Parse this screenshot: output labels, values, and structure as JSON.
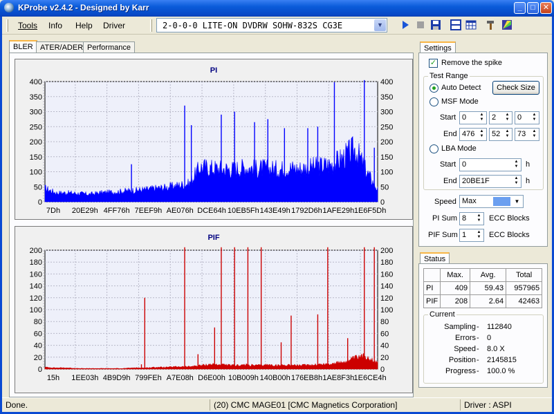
{
  "window": {
    "title": "KProbe v2.4.2 - Designed by Karr"
  },
  "menu": {
    "tools": "Tools",
    "info": "Info",
    "help": "Help",
    "driver": "Driver"
  },
  "drive": {
    "selected": "2-0-0-0 LITE-ON DVDRW SOHW-832S  CG3E"
  },
  "tabs": {
    "bler": "BLER",
    "ater": "ATER/ADER",
    "performance": "Performance"
  },
  "settings": {
    "tab": "Settings",
    "remove_spike": "Remove the spike",
    "test_range": "Test Range",
    "auto_detect": "Auto Detect",
    "check_size": "Check Size",
    "msf_mode": "MSF Mode",
    "start_label": "Start",
    "end_label": "End",
    "msf_start": [
      "0",
      "2",
      "0"
    ],
    "msf_end": [
      "476",
      "52",
      "73"
    ],
    "lba_mode": "LBA Mode",
    "lba_start": "0",
    "lba_end": "20BE1F",
    "h": "h",
    "speed_label": "Speed",
    "speed_value": "Max",
    "speed_color": "#6b9ff0",
    "pi_sum_label": "PI Sum",
    "pi_sum_value": "8",
    "pif_sum_label": "PIF Sum",
    "pif_sum_value": "1",
    "ecc_blocks": "ECC Blocks"
  },
  "status": {
    "tab": "Status",
    "headers": [
      "",
      "Max.",
      "Avg.",
      "Total"
    ],
    "rows": [
      {
        "name": "PI",
        "max": "409",
        "avg": "59.43",
        "total": "957965"
      },
      {
        "name": "PIF",
        "max": "208",
        "avg": "2.64",
        "total": "42463"
      }
    ],
    "current_label": "Current",
    "current": [
      {
        "key": "Sampling",
        "value": "112840"
      },
      {
        "key": "Errors",
        "value": "0"
      },
      {
        "key": "Speed",
        "value": "8.0  X"
      },
      {
        "key": "Position",
        "value": "2145815"
      },
      {
        "key": "Progress",
        "value": "100.0 %"
      }
    ]
  },
  "statusbar": {
    "message": "Done.",
    "disc": "(20) CMC MAGE01 [CMC Magnetics Corporation]",
    "driver": "Driver : ASPI"
  },
  "chart_data": [
    {
      "type": "area",
      "title": "PI",
      "ylim": [
        0,
        400
      ],
      "yticks": [
        0,
        50,
        100,
        150,
        200,
        250,
        300,
        350,
        400
      ],
      "x_tick_labels": [
        "7Dh",
        "20E29h",
        "4FF76h",
        "7EEF9h",
        "AE076h",
        "DCE64h",
        "10EB5Fh",
        "143E49h",
        "1792D6h",
        "1AFE29h",
        "1E6F5Dh"
      ],
      "color": "#0000ff",
      "baseline_profile": [
        45,
        30,
        30,
        28,
        25,
        30,
        32,
        35,
        38,
        40,
        45,
        48,
        55,
        60,
        115,
        112,
        110,
        108,
        115,
        110,
        112,
        108,
        112,
        110,
        115,
        120,
        125,
        150,
        175,
        100,
        40
      ],
      "spikes": [
        {
          "pos": 0.26,
          "value": 125
        },
        {
          "pos": 0.42,
          "value": 320
        },
        {
          "pos": 0.44,
          "value": 255
        },
        {
          "pos": 0.53,
          "value": 290
        },
        {
          "pos": 0.57,
          "value": 300
        },
        {
          "pos": 0.63,
          "value": 265
        },
        {
          "pos": 0.67,
          "value": 275
        },
        {
          "pos": 0.72,
          "value": 245
        },
        {
          "pos": 0.79,
          "value": 245
        },
        {
          "pos": 0.82,
          "value": 250
        },
        {
          "pos": 0.87,
          "value": 398
        },
        {
          "pos": 0.96,
          "value": 405
        },
        {
          "pos": 0.99,
          "value": 180
        }
      ]
    },
    {
      "type": "area",
      "title": "PIF",
      "ylim": [
        0,
        200
      ],
      "yticks": [
        0,
        20,
        40,
        60,
        80,
        100,
        120,
        140,
        160,
        180,
        200
      ],
      "x_tick_labels": [
        "15h",
        "1EE03h",
        "4B9D9h",
        "799FEh",
        "A7E08h",
        "D6E00h",
        "10B009h",
        "140B00h",
        "176EB8h",
        "1AE8F3h",
        "1E6CE4h"
      ],
      "color": "#cc0000",
      "baseline_profile": [
        3,
        2,
        2,
        1,
        1,
        1,
        1,
        1,
        2,
        2,
        3,
        3,
        4,
        4,
        6,
        8,
        7,
        6,
        7,
        6,
        7,
        6,
        7,
        6,
        7,
        8,
        9,
        12,
        18,
        22,
        10
      ],
      "spikes": [
        {
          "pos": 0.29,
          "value": 8
        },
        {
          "pos": 0.3,
          "value": 120
        },
        {
          "pos": 0.42,
          "value": 205
        },
        {
          "pos": 0.46,
          "value": 25
        },
        {
          "pos": 0.51,
          "value": 70
        },
        {
          "pos": 0.53,
          "value": 205
        },
        {
          "pos": 0.57,
          "value": 205
        },
        {
          "pos": 0.61,
          "value": 205
        },
        {
          "pos": 0.65,
          "value": 205
        },
        {
          "pos": 0.71,
          "value": 45
        },
        {
          "pos": 0.74,
          "value": 90
        },
        {
          "pos": 0.82,
          "value": 92
        },
        {
          "pos": 0.85,
          "value": 205
        },
        {
          "pos": 0.91,
          "value": 52
        },
        {
          "pos": 0.96,
          "value": 205
        },
        {
          "pos": 0.99,
          "value": 205
        }
      ]
    }
  ]
}
